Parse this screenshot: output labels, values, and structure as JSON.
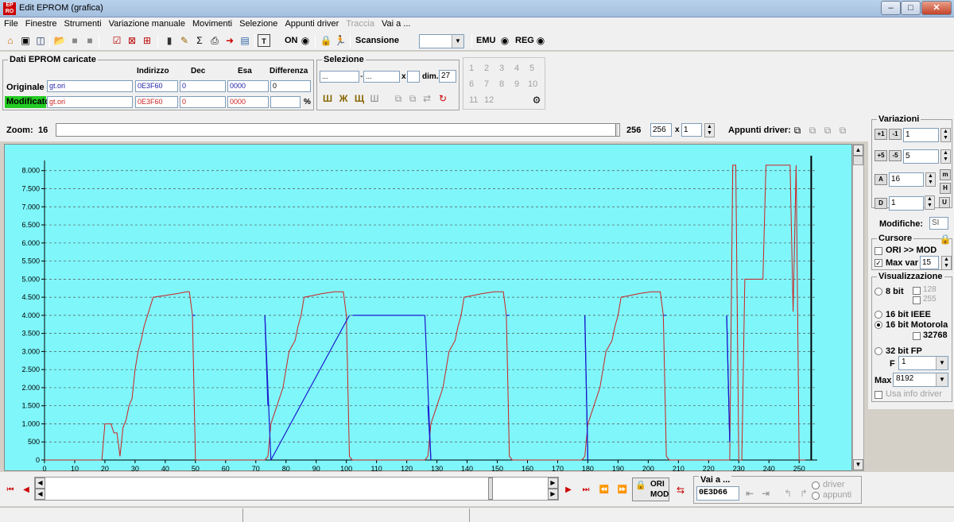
{
  "window": {
    "title": "Edit EPROM (grafica)",
    "icon_label": "EP\nRO"
  },
  "menu": [
    "File",
    "Finestre",
    "Strumenti",
    "Variazione manuale",
    "Movimenti",
    "Selezione",
    "Appunti driver",
    "Traccia",
    "Vai a ..."
  ],
  "menu_disabled": [
    "Traccia"
  ],
  "toolbar": {
    "on_label": "ON",
    "scan_label": "Scansione",
    "emu_label": "EMU",
    "reg_label": "REG"
  },
  "eprom": {
    "legend": "Dati EPROM caricate",
    "headers": {
      "indirizzo": "Indirizzo",
      "dec": "Dec",
      "esa": "Esa",
      "differenza": "Differenza"
    },
    "originale": {
      "label": "Originale",
      "file": "gt.ori",
      "indirizzo": "0E3F60",
      "dec": "0",
      "esa": "0000",
      "differenza": "0"
    },
    "modificato": {
      "label": "Modificato",
      "file": "gt.ori",
      "indirizzo": "0E3F60",
      "dec": "0",
      "esa": "0000",
      "differenza": "",
      "pct": "%"
    }
  },
  "selezione": {
    "legend": "Selezione",
    "from": "...",
    "to": "...",
    "x_label": "x",
    "dim_label": "dim.",
    "dim_value": "27"
  },
  "numpad": [
    "1",
    "2",
    "3",
    "4",
    "5",
    "6",
    "7",
    "8",
    "9",
    "10",
    "11",
    "12"
  ],
  "zoom": {
    "label": "Zoom:",
    "value": "16",
    "end_value": "256",
    "field_value": "256",
    "x_label": "x",
    "multiplier": "1",
    "appunti_label": "Appunti driver:"
  },
  "variazioni": {
    "legend": "Variazioni",
    "v1": "1",
    "v2": "5",
    "v3": "16",
    "v4": "1",
    "modifiche_label": "Modifiche:",
    "modifiche_value": "SI"
  },
  "cursore": {
    "legend": "Cursore",
    "ori_mod_label": "ORI >> MOD",
    "ori_mod_checked": false,
    "max_var_label": "Max var",
    "max_var_checked": true,
    "max_var_value": "15"
  },
  "visualizzazione": {
    "legend": "Visualizzazione",
    "bit8": "8 bit",
    "opt128": "128",
    "opt255": "255",
    "ieee": "16 bit IEEE",
    "motorola": "16 bit Motorola",
    "opt32768": "32768",
    "fp32": "32 bit FP",
    "f_label": "F",
    "f_value": "1",
    "max_label": "Max",
    "max_value": "8192",
    "usa_info": "Usa info driver",
    "selected": "16 bit Motorola"
  },
  "bottom": {
    "vai_label": "Vai a ...",
    "vai_value": "0E3D66",
    "ori_label": "ORI",
    "mod_label": "MOD",
    "driver_label": "driver",
    "appunti_label": "appunti"
  },
  "colors": {
    "plot_bg": "#7ff6fa",
    "original": "#cc2222",
    "modified": "#1a1acc",
    "modificato_bg": "#22cc22"
  },
  "chart_data": {
    "type": "line",
    "xlim": [
      0,
      256
    ],
    "ylim": [
      0,
      8192
    ],
    "x_ticks": [
      0,
      10,
      20,
      30,
      40,
      50,
      60,
      70,
      80,
      90,
      100,
      110,
      120,
      130,
      140,
      150,
      160,
      170,
      180,
      190,
      200,
      210,
      220,
      230,
      240,
      250
    ],
    "y_ticks": [
      0,
      500,
      1000,
      1500,
      2000,
      2500,
      3000,
      3500,
      4000,
      4500,
      5000,
      5500,
      6000,
      6500,
      7000,
      7500,
      8000
    ],
    "y_tick_labels": [
      "0",
      "500",
      "1.000",
      "1.500",
      "2.000",
      "2.500",
      "3.000",
      "3.500",
      "4.000",
      "4.500",
      "5.000",
      "5.500",
      "6.000",
      "6.500",
      "7.000",
      "7.500",
      "8.000"
    ],
    "grid": true,
    "cursor_x": 254,
    "series": [
      {
        "color": "#cc2222",
        "x": [
          0,
          19,
          20,
          22,
          23,
          24,
          25,
          26,
          27,
          28,
          29,
          30,
          31,
          32,
          33,
          36,
          40,
          44,
          47,
          48,
          49,
          50,
          73,
          74,
          75,
          77,
          79,
          81,
          83,
          84,
          85,
          86,
          89,
          92,
          96,
          99,
          100,
          101,
          102,
          126,
          127,
          128,
          130,
          132,
          134,
          136,
          137,
          138,
          139,
          142,
          145,
          149,
          152,
          153,
          154,
          155,
          178,
          179,
          180,
          182,
          184,
          186,
          188,
          189,
          190,
          191,
          194,
          197,
          201,
          204,
          205,
          206,
          207,
          227,
          228,
          229,
          230,
          231,
          232,
          233,
          234,
          238,
          239,
          247,
          248,
          249,
          250,
          251,
          252
        ],
        "y": [
          0,
          0,
          1000,
          1000,
          750,
          750,
          100,
          900,
          1100,
          1500,
          1700,
          2500,
          3000,
          3300,
          3700,
          4500,
          4550,
          4600,
          4650,
          4650,
          4000,
          0,
          0,
          100,
          1000,
          1500,
          2000,
          3000,
          3300,
          3700,
          4000,
          4500,
          4550,
          4600,
          4650,
          4650,
          4000,
          100,
          0,
          0,
          100,
          1000,
          1500,
          2000,
          3000,
          3300,
          3700,
          4000,
          4500,
          4550,
          4600,
          4650,
          4650,
          4000,
          100,
          0,
          0,
          100,
          1000,
          1500,
          2000,
          3000,
          3300,
          3700,
          4000,
          4500,
          4550,
          4600,
          4650,
          4650,
          4000,
          100,
          0,
          0,
          8150,
          8150,
          0,
          0,
          5000,
          5000,
          5000,
          5000,
          8150,
          8150,
          4100,
          8150,
          0,
          0,
          0
        ]
      },
      {
        "color": "#1a1acc",
        "x": [
          49,
          50,
          73,
          74,
          75,
          101,
          102,
          126,
          127,
          128,
          153,
          154,
          179,
          180,
          205,
          206,
          226,
          227
        ],
        "y": [
          4000,
          4000,
          4000,
          1500,
          0,
          4000,
          4000,
          4000,
          1500,
          0,
          4000,
          4000,
          4000,
          0,
          4000,
          4000,
          4000,
          500
        ]
      }
    ]
  }
}
